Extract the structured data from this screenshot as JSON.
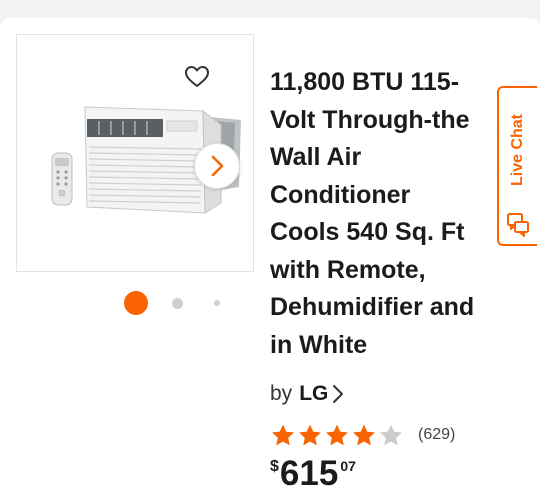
{
  "product": {
    "title_lines": [
      "11,800 BTU 115-",
      "Volt Through-the",
      "Wall Air",
      "Conditioner",
      "Cools 540 Sq. Ft",
      "with Remote,",
      "Dehumidifier and",
      "in White"
    ],
    "by_label": "by",
    "brand": "LG",
    "rating": {
      "value": 4,
      "max": 5,
      "count_label": "(629)"
    },
    "price": {
      "currency": "$",
      "dollars": "615",
      "cents": "07"
    }
  },
  "gallery": {
    "active_index": 0,
    "image_icon": "air-conditioner-with-remote",
    "favorite_icon": "heart-outline-icon",
    "next_icon": "chevron-right-icon"
  },
  "live_chat": {
    "label": "Live Chat",
    "icon": "chat-bubbles-icon"
  },
  "colors": {
    "accent": "#f96302",
    "star_filled": "#f96302",
    "star_empty": "#cccccc"
  }
}
